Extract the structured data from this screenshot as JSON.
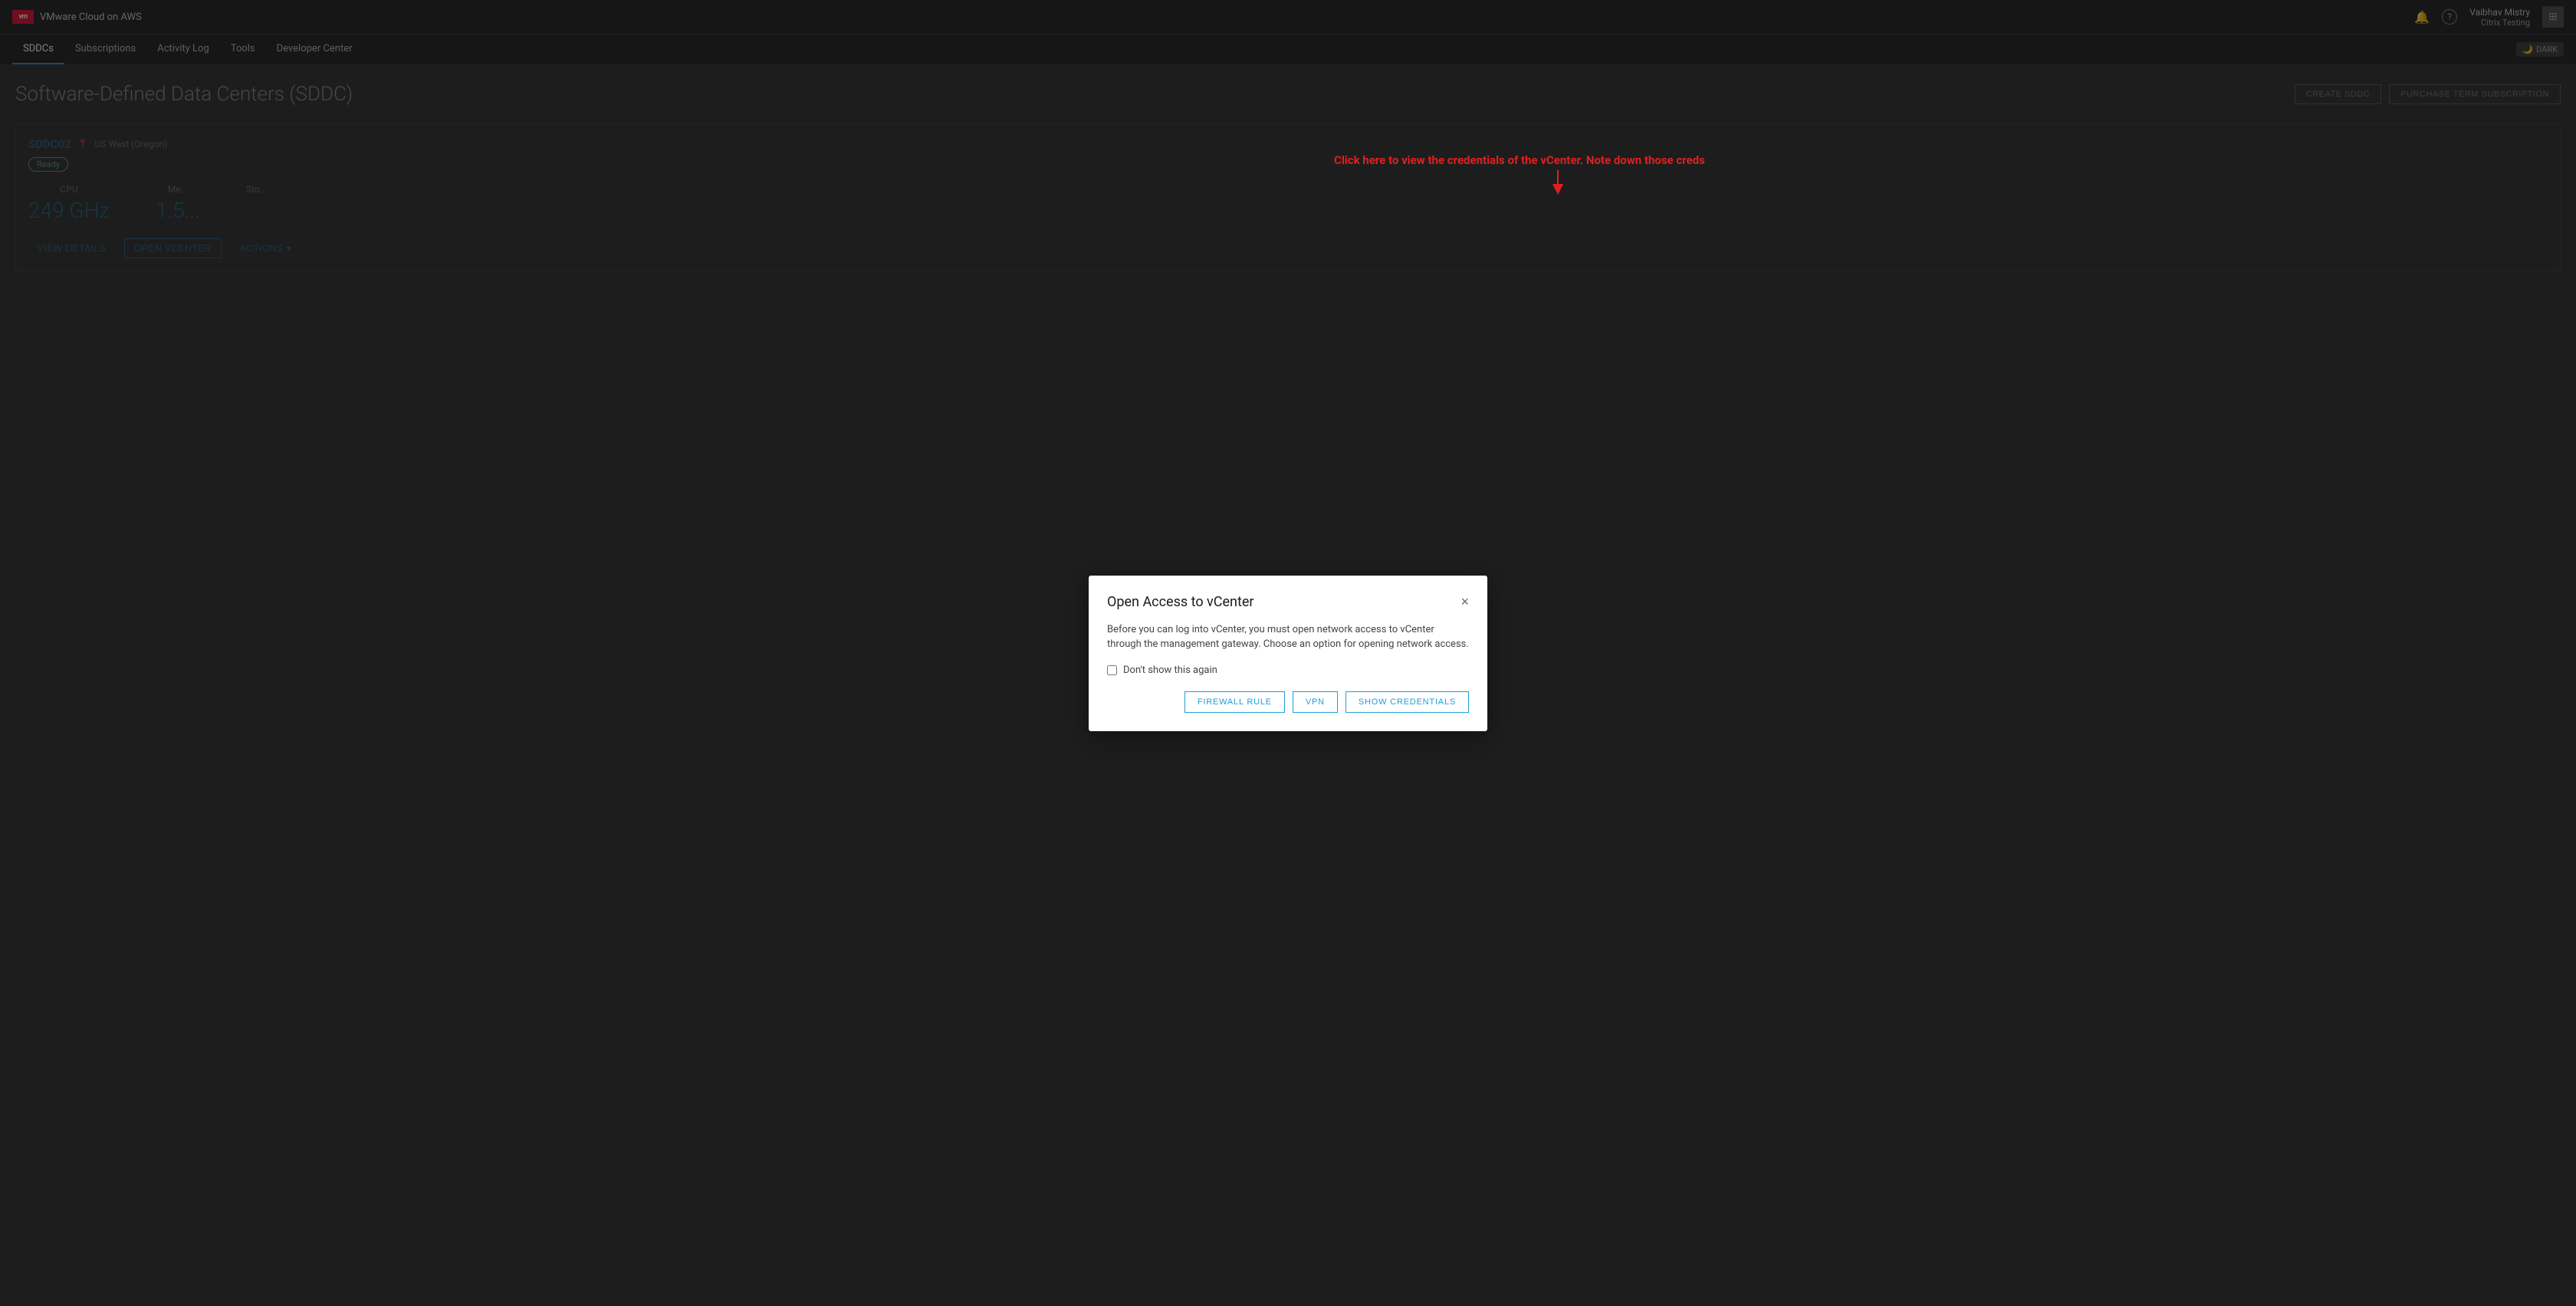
{
  "topbar": {
    "logo_text": "vm",
    "app_title": "VMware Cloud on AWS",
    "notification_icon": "🔔",
    "help_icon": "?",
    "user_name": "Vaibhav Mistry",
    "user_org": "Citrix Testing",
    "grid_icon": "⊞"
  },
  "navbar": {
    "items": [
      {
        "label": "SDDCs",
        "active": true
      },
      {
        "label": "Subscriptions",
        "active": false
      },
      {
        "label": "Activity Log",
        "active": false
      },
      {
        "label": "Tools",
        "active": false
      },
      {
        "label": "Developer Center",
        "active": false
      }
    ],
    "dark_mode_label": "DARK"
  },
  "page": {
    "title": "Software-Defined Data Centers (SDDC)",
    "create_button": "CREATE SDDC",
    "purchase_button": "PURCHASE TERM SUBSCRIPTION"
  },
  "sddc_card": {
    "name": "SDDC02",
    "location_icon": "📍",
    "location": "US West (Oregon)",
    "status": "Ready",
    "metrics": [
      {
        "label": "CPU",
        "value": "249 GHz"
      },
      {
        "label": "Me...",
        "value": "1.5..."
      },
      {
        "label": "Sto...",
        "value": ""
      }
    ],
    "actions": [
      {
        "label": "VIEW DETAILS"
      },
      {
        "label": "OPEN VCENTER"
      },
      {
        "label": "ACTIONS ▾"
      }
    ]
  },
  "modal": {
    "title": "Open Access to vCenter",
    "body": "Before you can log into vCenter, you must open network access to vCenter through the management gateway. Choose an option for opening network access.",
    "checkbox_label": "Don't show this again",
    "buttons": [
      {
        "label": "FIREWALL RULE"
      },
      {
        "label": "VPN"
      },
      {
        "label": "SHOW CREDENTIALS"
      }
    ],
    "close_icon": "×"
  },
  "annotation": {
    "text": "Click here to view the credentials of the vCenter. Note down those creds"
  }
}
